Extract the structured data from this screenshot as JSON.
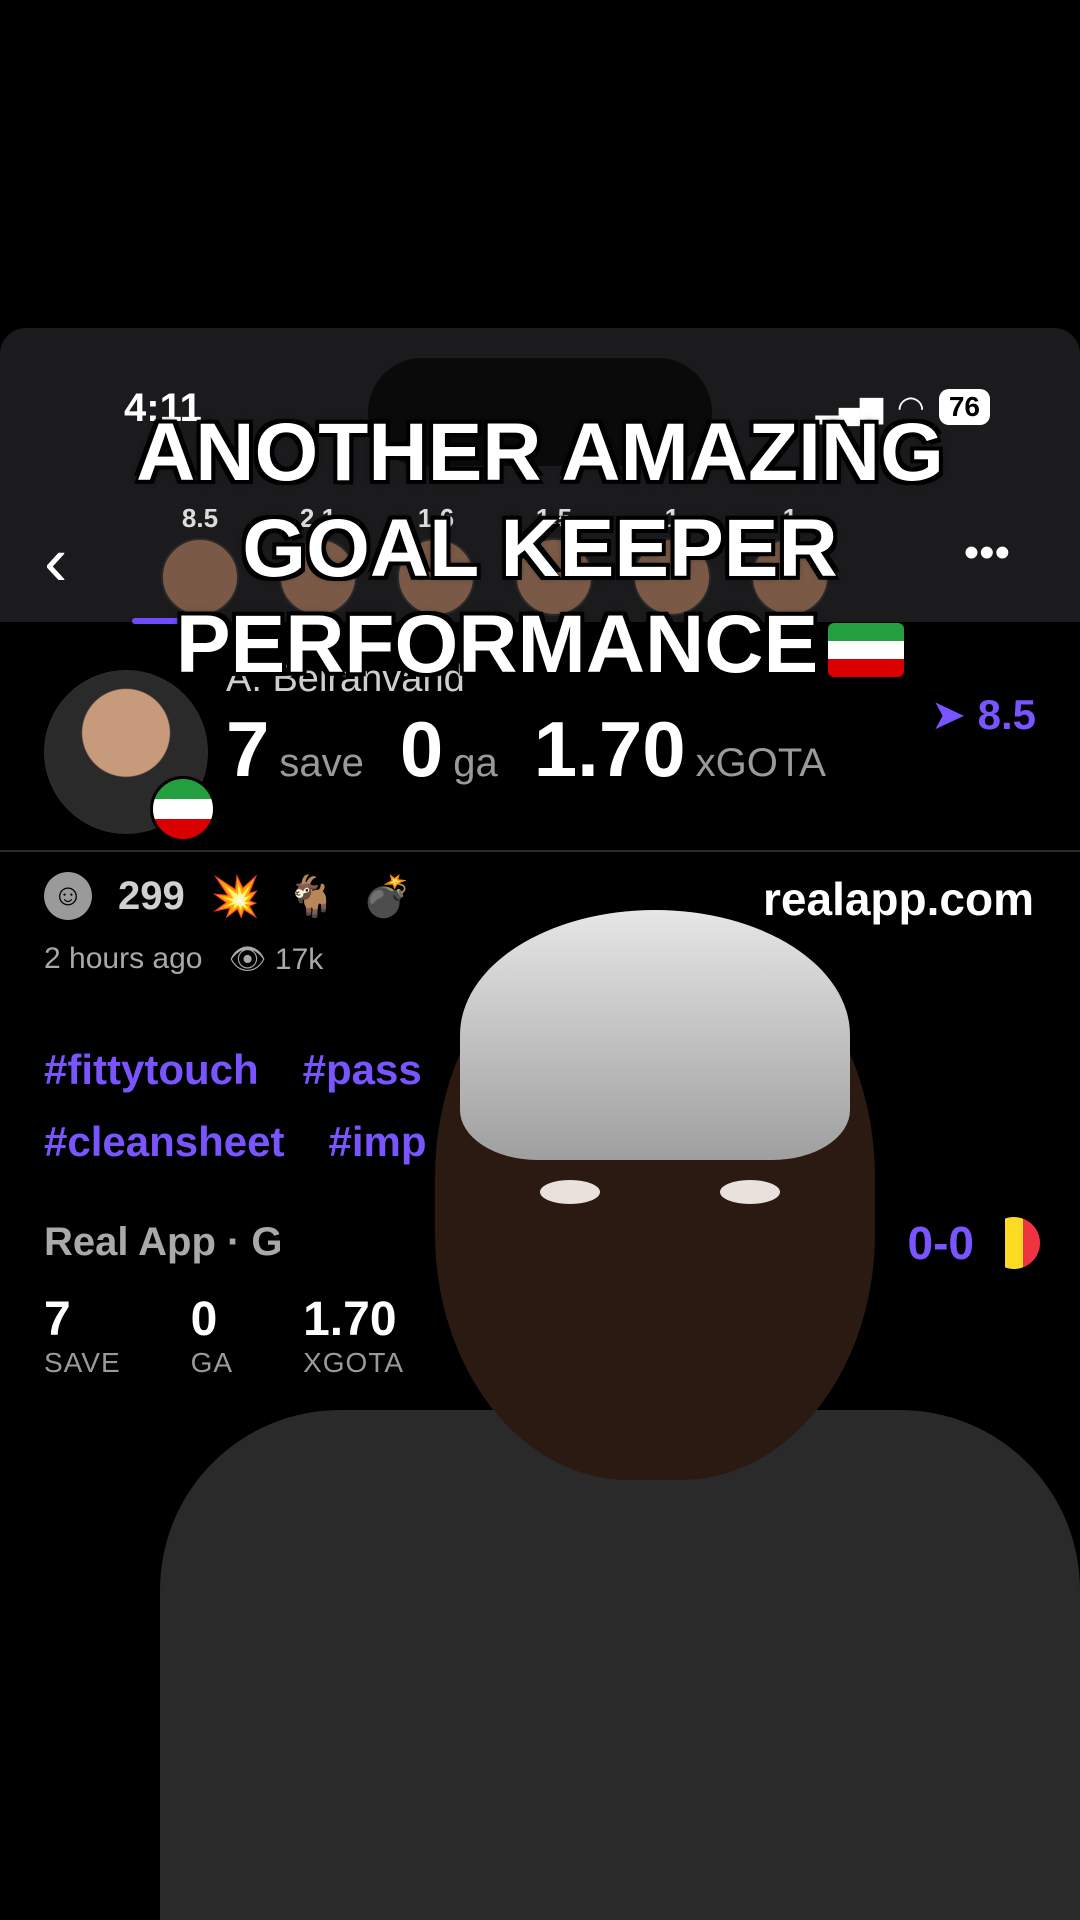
{
  "status": {
    "time": "4:11",
    "battery": "76"
  },
  "rail": {
    "back": "‹",
    "ratings": [
      "8.5",
      "2.1",
      "1.6",
      "1.5",
      "1",
      "1"
    ],
    "more": "•••"
  },
  "player": {
    "name": "A. Beiranvand",
    "rating": "8.5",
    "saves_value": "7",
    "saves_label": "save",
    "ga_value": "0",
    "ga_label": "ga",
    "xgota_value": "1.70",
    "xgota_label": "xGOTA"
  },
  "reactions": {
    "smiley_count": "299",
    "emojis": [
      "💥",
      "🐐",
      "💣"
    ]
  },
  "site": "realapp.com",
  "meta": {
    "time_ago": "2 hours ago",
    "views": "17k"
  },
  "tags": [
    "#fittytouch",
    "#pass",
    "#cleansheet",
    "#imp"
  ],
  "match": {
    "source": "Real App · G",
    "score": "0-0"
  },
  "stat_table": [
    {
      "value": "7",
      "label": "SAVE"
    },
    {
      "value": "0",
      "label": "GA"
    },
    {
      "value": "1.70",
      "label": "XGOTA"
    }
  ],
  "caption": {
    "line1": "ANOTHER AMAZING",
    "line2": "GOAL KEEPER",
    "line3": "PERFORMANCE"
  },
  "colors": {
    "accent": "#7a55ff",
    "background": "#000000"
  }
}
